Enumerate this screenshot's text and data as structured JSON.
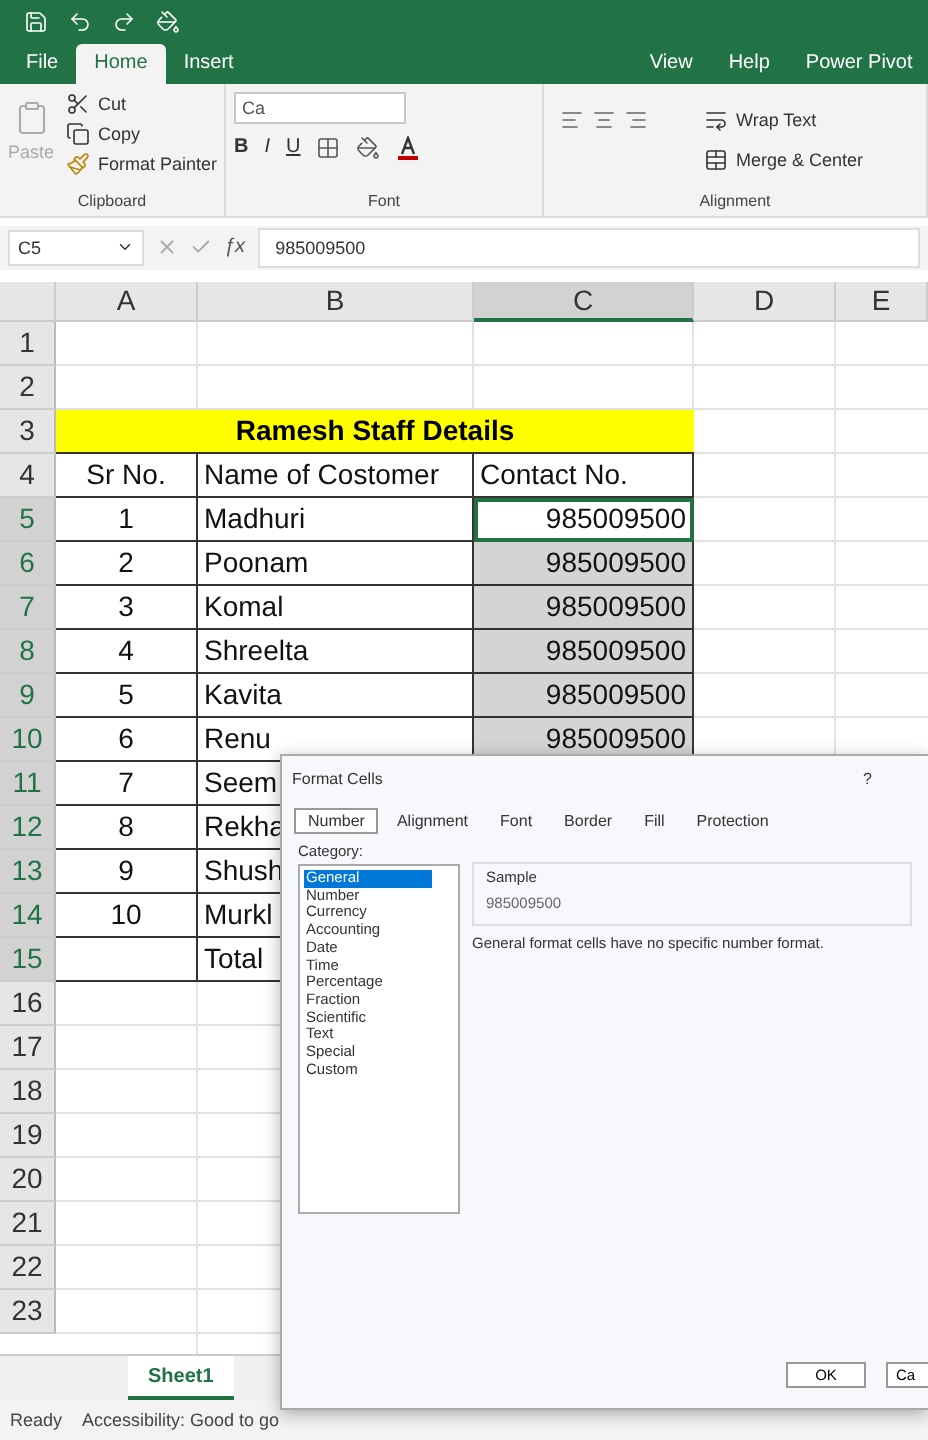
{
  "tabs": [
    {
      "label": "File",
      "selected": false
    },
    {
      "label": "Home",
      "selected": true
    },
    {
      "label": "Insert",
      "selected": false
    },
    {
      "label": "View",
      "selected": false
    },
    {
      "label": "Help",
      "selected": false
    },
    {
      "label": "Power Pivot",
      "selected": false
    }
  ],
  "ribbon": {
    "clipboard": {
      "label": "Clipboard",
      "paste": "Paste",
      "cut": "Cut",
      "copy": "Copy",
      "format_painter": "Format Painter"
    },
    "font": {
      "label": "Font",
      "font_name": "Ca",
      "bold": "B",
      "italic": "I",
      "underline": "U"
    },
    "alignment": {
      "label": "Alignment",
      "wrap_text": "Wrap Text",
      "merge_center": "Merge & Center"
    }
  },
  "formula_bar": {
    "name_box": "C5",
    "function": "ƒx",
    "value": "985009500"
  },
  "columns": [
    {
      "label": "A",
      "selected": false
    },
    {
      "label": "B",
      "selected": false
    },
    {
      "label": "C",
      "selected": true
    },
    {
      "label": "D",
      "selected": false
    },
    {
      "label": "E",
      "selected": false
    }
  ],
  "rows": [
    {
      "number": "1",
      "selected": false,
      "kind": "empty"
    },
    {
      "number": "2",
      "selected": false,
      "kind": "empty"
    },
    {
      "number": "3",
      "selected": false,
      "kind": "title",
      "text": "Ramesh Staff Details"
    },
    {
      "number": "4",
      "selected": false,
      "kind": "header",
      "cells": [
        "Sr No.",
        "Name of Costomer",
        "Contact No."
      ]
    },
    {
      "number": "5",
      "selected": true,
      "kind": "data",
      "cells": [
        "1",
        "Madhuri",
        "985009500"
      ],
      "active": true,
      "range": false
    },
    {
      "number": "6",
      "selected": true,
      "kind": "data",
      "cells": [
        "2",
        "Poonam",
        "985009500"
      ],
      "active": false,
      "range": true
    },
    {
      "number": "7",
      "selected": true,
      "kind": "data",
      "cells": [
        "3",
        "Komal",
        "985009500"
      ],
      "active": false,
      "range": true
    },
    {
      "number": "8",
      "selected": true,
      "kind": "data",
      "cells": [
        "4",
        "Shreelta",
        "985009500"
      ],
      "active": false,
      "range": true
    },
    {
      "number": "9",
      "selected": true,
      "kind": "data",
      "cells": [
        "5",
        "Kavita",
        "985009500"
      ],
      "active": false,
      "range": true
    },
    {
      "number": "10",
      "selected": true,
      "kind": "data",
      "cells": [
        "6",
        "Renu",
        "985009500"
      ],
      "active": false,
      "range": true
    },
    {
      "number": "11",
      "selected": true,
      "kind": "data",
      "cells": [
        "7",
        "Seem"
      ]
    },
    {
      "number": "12",
      "selected": true,
      "kind": "data",
      "cells": [
        "8",
        "Rekha"
      ]
    },
    {
      "number": "13",
      "selected": true,
      "kind": "data",
      "cells": [
        "9",
        "Shush"
      ]
    },
    {
      "number": "14",
      "selected": true,
      "kind": "data",
      "cells": [
        "10",
        "Murkl"
      ]
    },
    {
      "number": "15",
      "selected": true,
      "kind": "data",
      "cells": [
        "",
        "Total"
      ]
    },
    {
      "number": "16",
      "selected": false,
      "kind": "empty"
    },
    {
      "number": "17",
      "selected": false,
      "kind": "empty"
    },
    {
      "number": "18",
      "selected": false,
      "kind": "empty"
    },
    {
      "number": "19",
      "selected": false,
      "kind": "empty"
    },
    {
      "number": "20",
      "selected": false,
      "kind": "empty"
    },
    {
      "number": "21",
      "selected": false,
      "kind": "empty"
    },
    {
      "number": "22",
      "selected": false,
      "kind": "empty"
    },
    {
      "number": "23",
      "selected": false,
      "kind": "empty"
    }
  ],
  "sheet_tabs": [
    {
      "label": "Sheet1",
      "selected": true
    }
  ],
  "status_bar": {
    "state": "Ready",
    "accessibility": "Accessibility: Good to go"
  },
  "dialog": {
    "title": "Format Cells",
    "help": "?",
    "tabs": [
      {
        "label": "Number",
        "selected": true
      },
      {
        "label": "Alignment",
        "selected": false
      },
      {
        "label": "Font",
        "selected": false
      },
      {
        "label": "Border",
        "selected": false
      },
      {
        "label": "Fill",
        "selected": false
      },
      {
        "label": "Protection",
        "selected": false
      }
    ],
    "category_label": "Category:",
    "categories": [
      {
        "label": "General",
        "selected": true
      },
      {
        "label": "Number",
        "selected": false
      },
      {
        "label": "Currency",
        "selected": false
      },
      {
        "label": "Accounting",
        "selected": false
      },
      {
        "label": "Date",
        "selected": false
      },
      {
        "label": "Time",
        "selected": false
      },
      {
        "label": "Percentage",
        "selected": false
      },
      {
        "label": "Fraction",
        "selected": false
      },
      {
        "label": "Scientific",
        "selected": false
      },
      {
        "label": "Text",
        "selected": false
      },
      {
        "label": "Special",
        "selected": false
      },
      {
        "label": "Custom",
        "selected": false
      }
    ],
    "sample_label": "Sample",
    "sample_value": "985009500",
    "description": "General format cells have no specific number format.",
    "buttons": [
      "OK",
      "Ca"
    ]
  }
}
